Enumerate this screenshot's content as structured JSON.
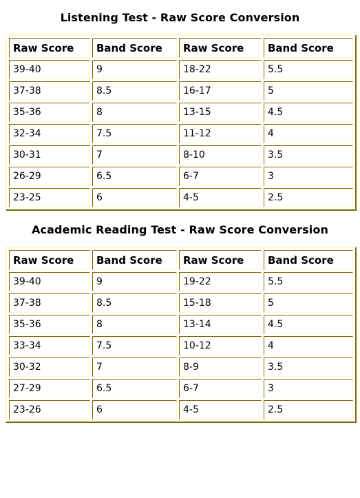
{
  "tables": [
    {
      "id": "listening",
      "title": "Listening Test - Raw Score Conversion",
      "columns": [
        "Raw Score",
        "Band Score",
        "Raw Score",
        "Band Score"
      ],
      "rows": [
        [
          "39-40",
          "9",
          "18-22",
          "5.5"
        ],
        [
          "37-38",
          "8.5",
          "16-17",
          "5"
        ],
        [
          "35-36",
          "8",
          "13-15",
          "4.5"
        ],
        [
          "32-34",
          "7.5",
          "11-12",
          "4"
        ],
        [
          "30-31",
          "7",
          "8-10",
          "3.5"
        ],
        [
          "26-29",
          "6.5",
          "6-7",
          "3"
        ],
        [
          "23-25",
          "6",
          "4-5",
          "2.5"
        ]
      ]
    },
    {
      "id": "reading",
      "title": "Academic Reading Test - Raw Score Conversion",
      "columns": [
        "Raw Score",
        "Band Score",
        "Raw Score",
        "Band Score"
      ],
      "rows": [
        [
          "39-40",
          "9",
          "19-22",
          "5.5"
        ],
        [
          "37-38",
          "8.5",
          "15-18",
          "5"
        ],
        [
          "35-36",
          "8",
          "13-14",
          "4.5"
        ],
        [
          "33-34",
          "7.5",
          "10-12",
          "4"
        ],
        [
          "30-32",
          "7",
          "8-9",
          "3.5"
        ],
        [
          "27-29",
          "6.5",
          "6-7",
          "3"
        ],
        [
          "23-26",
          "6",
          "4-5",
          "2.5"
        ]
      ]
    }
  ],
  "colors": {
    "cell_border_dark": "#7d6608",
    "cell_border_light": "#fdf6d0",
    "background": "#ffffff",
    "text": "#000000"
  }
}
